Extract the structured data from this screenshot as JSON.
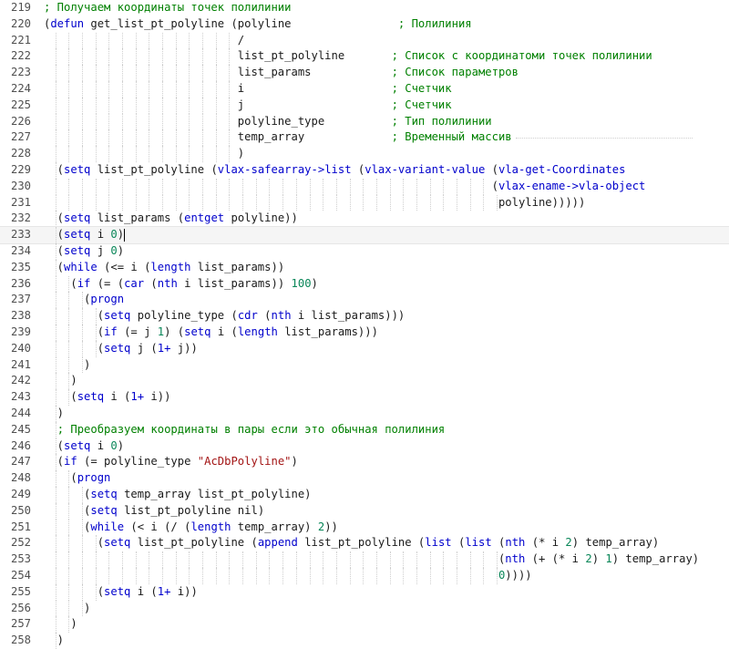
{
  "editor": {
    "lines": [
      {
        "num": "219",
        "text": "; Получаем координаты точек полилинии"
      },
      {
        "num": "220",
        "text": "(defun get_list_pt_polyline (polyline                ; Полилиния"
      },
      {
        "num": "221",
        "text": "                             /"
      },
      {
        "num": "222",
        "text": "                             list_pt_polyline       ; Список с координатоми точек полилинии"
      },
      {
        "num": "223",
        "text": "                             list_params            ; Список параметров"
      },
      {
        "num": "224",
        "text": "                             i                      ; Счетчик"
      },
      {
        "num": "225",
        "text": "                             j                      ; Счетчик"
      },
      {
        "num": "226",
        "text": "                             polyline_type          ; Тип полилинии"
      },
      {
        "num": "227",
        "text": "                             temp_array             ; Временный массив"
      },
      {
        "num": "228",
        "text": "                             )"
      },
      {
        "num": "229",
        "text": "  (setq list_pt_polyline (vlax-safearray->list (vlax-variant-value (vla-get-Coordinates"
      },
      {
        "num": "230",
        "text": "                                                                   (vlax-ename->vla-object"
      },
      {
        "num": "231",
        "text": "                                                                    polyline)))))"
      },
      {
        "num": "232",
        "text": "  (setq list_params (entget polyline))"
      },
      {
        "num": "233",
        "text": "  (setq i 0)"
      },
      {
        "num": "234",
        "text": "  (setq j 0)"
      },
      {
        "num": "235",
        "text": "  (while (<= i (length list_params))"
      },
      {
        "num": "236",
        "text": "    (if (= (car (nth i list_params)) 100)"
      },
      {
        "num": "237",
        "text": "      (progn"
      },
      {
        "num": "238",
        "text": "        (setq polyline_type (cdr (nth i list_params)))"
      },
      {
        "num": "239",
        "text": "        (if (= j 1) (setq i (length list_params)))"
      },
      {
        "num": "240",
        "text": "        (setq j (1+ j))"
      },
      {
        "num": "241",
        "text": "      )"
      },
      {
        "num": "242",
        "text": "    )"
      },
      {
        "num": "243",
        "text": "    (setq i (1+ i))"
      },
      {
        "num": "244",
        "text": "  )"
      },
      {
        "num": "245",
        "text": "  ; Преобразуем координаты в пары если это обычная полилиния"
      },
      {
        "num": "246",
        "text": "  (setq i 0)"
      },
      {
        "num": "247",
        "text": "  (if (= polyline_type \"AcDbPolyline\")"
      },
      {
        "num": "248",
        "text": "    (progn"
      },
      {
        "num": "249",
        "text": "      (setq temp_array list_pt_polyline)"
      },
      {
        "num": "250",
        "text": "      (setq list_pt_polyline nil)"
      },
      {
        "num": "251",
        "text": "      (while (< i (/ (length temp_array) 2))"
      },
      {
        "num": "252",
        "text": "        (setq list_pt_polyline (append list_pt_polyline (list (list (nth (* i 2) temp_array)"
      },
      {
        "num": "253",
        "text": "                                                                    (nth (+ (* i 2) 1) temp_array)"
      },
      {
        "num": "254",
        "text": "                                                                    0))))"
      },
      {
        "num": "255",
        "text": "        (setq i (1+ i))"
      },
      {
        "num": "256",
        "text": "      )"
      },
      {
        "num": "257",
        "text": "    )"
      },
      {
        "num": "258",
        "text": "  )"
      }
    ],
    "current_line": "233",
    "colors": {
      "keyword": "#0000cc",
      "comment": "#008000",
      "string": "#a31515",
      "number": "#098658",
      "text": "#1a1a1a",
      "line_number": "#505050"
    }
  }
}
